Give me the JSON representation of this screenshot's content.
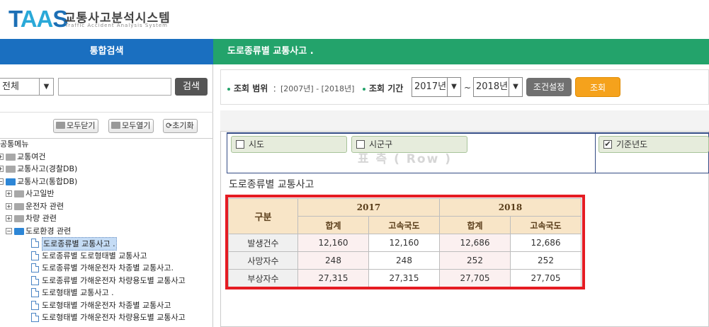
{
  "header": {
    "logo_text": "TAAS",
    "app_title": "교통사고분석시스템",
    "app_subtitle": "Traffic Accident Analysis System"
  },
  "left": {
    "title": "통합검색",
    "scope_value": "전체",
    "search_value": "",
    "search_button": "검색",
    "collapse_all": "모두닫기",
    "expand_all": "모두열기",
    "reset": "초기화",
    "tree": [
      {
        "label": "공통메뉴",
        "level": 0,
        "type": "text"
      },
      {
        "label": "교통여건",
        "level": 0,
        "type": "folder-gray"
      },
      {
        "label": "교통사고(경찰DB)",
        "level": 0,
        "type": "folder-gray"
      },
      {
        "label": "교통사고(통합DB)",
        "level": 0,
        "type": "folder-blue"
      },
      {
        "label": "사고일반",
        "level": 1,
        "type": "folder-gray"
      },
      {
        "label": "운전자 관련",
        "level": 1,
        "type": "folder-gray"
      },
      {
        "label": "차량 관련",
        "level": 1,
        "type": "folder-gray"
      },
      {
        "label": "도로환경 관련",
        "level": 1,
        "type": "folder-blue"
      },
      {
        "label": "도로종류별 교통사고 .",
        "level": 2,
        "type": "doc",
        "selected": true
      },
      {
        "label": "도로종류별 도로형태별 교통사고",
        "level": 2,
        "type": "doc"
      },
      {
        "label": "도로종류별 가해운전자 차종별 교통사고.",
        "level": 2,
        "type": "doc"
      },
      {
        "label": "도로종류별 가해운전자 차량용도별 교통사고",
        "level": 2,
        "type": "doc"
      },
      {
        "label": "도로형태별 교통사고 .",
        "level": 2,
        "type": "doc"
      },
      {
        "label": "도로형태별 가해운전자 차종별 교통사고",
        "level": 2,
        "type": "doc"
      },
      {
        "label": "도로형태별 가해운전자 차량용도별 교통사고",
        "level": 2,
        "type": "doc"
      }
    ]
  },
  "right": {
    "title": "도로종류별 교통사고 .",
    "range_label": "조회 범위",
    "range_value": "：[2007년] - [2018년]",
    "period_label": "조회 기간",
    "from_year": "2017년",
    "tilde": "~",
    "to_year": "2018년",
    "settings_button": "조건설정",
    "query_button": "조회",
    "row_fields": [
      "시도",
      "시군구"
    ],
    "col_fields": [
      "기준년도"
    ],
    "row_watermark": "표 측 ( Row )",
    "table_title": "도로종류별 교통사고"
  },
  "table": {
    "corner": "구분",
    "years": [
      "2017",
      "2018"
    ],
    "subheaders": [
      "합계",
      "고속국도",
      "합계",
      "고속국도"
    ],
    "rows": [
      {
        "label": "발생건수",
        "values": [
          "12,160",
          "12,160",
          "12,686",
          "12,686"
        ]
      },
      {
        "label": "사망자수",
        "values": [
          "248",
          "248",
          "252",
          "252"
        ]
      },
      {
        "label": "부상자수",
        "values": [
          "27,315",
          "27,315",
          "27,705",
          "27,705"
        ]
      }
    ]
  },
  "colors": {
    "left_header": "#1a6fc0",
    "right_header": "#23a36b",
    "query_button": "#f5a21c",
    "highlight": "#e51c23"
  }
}
